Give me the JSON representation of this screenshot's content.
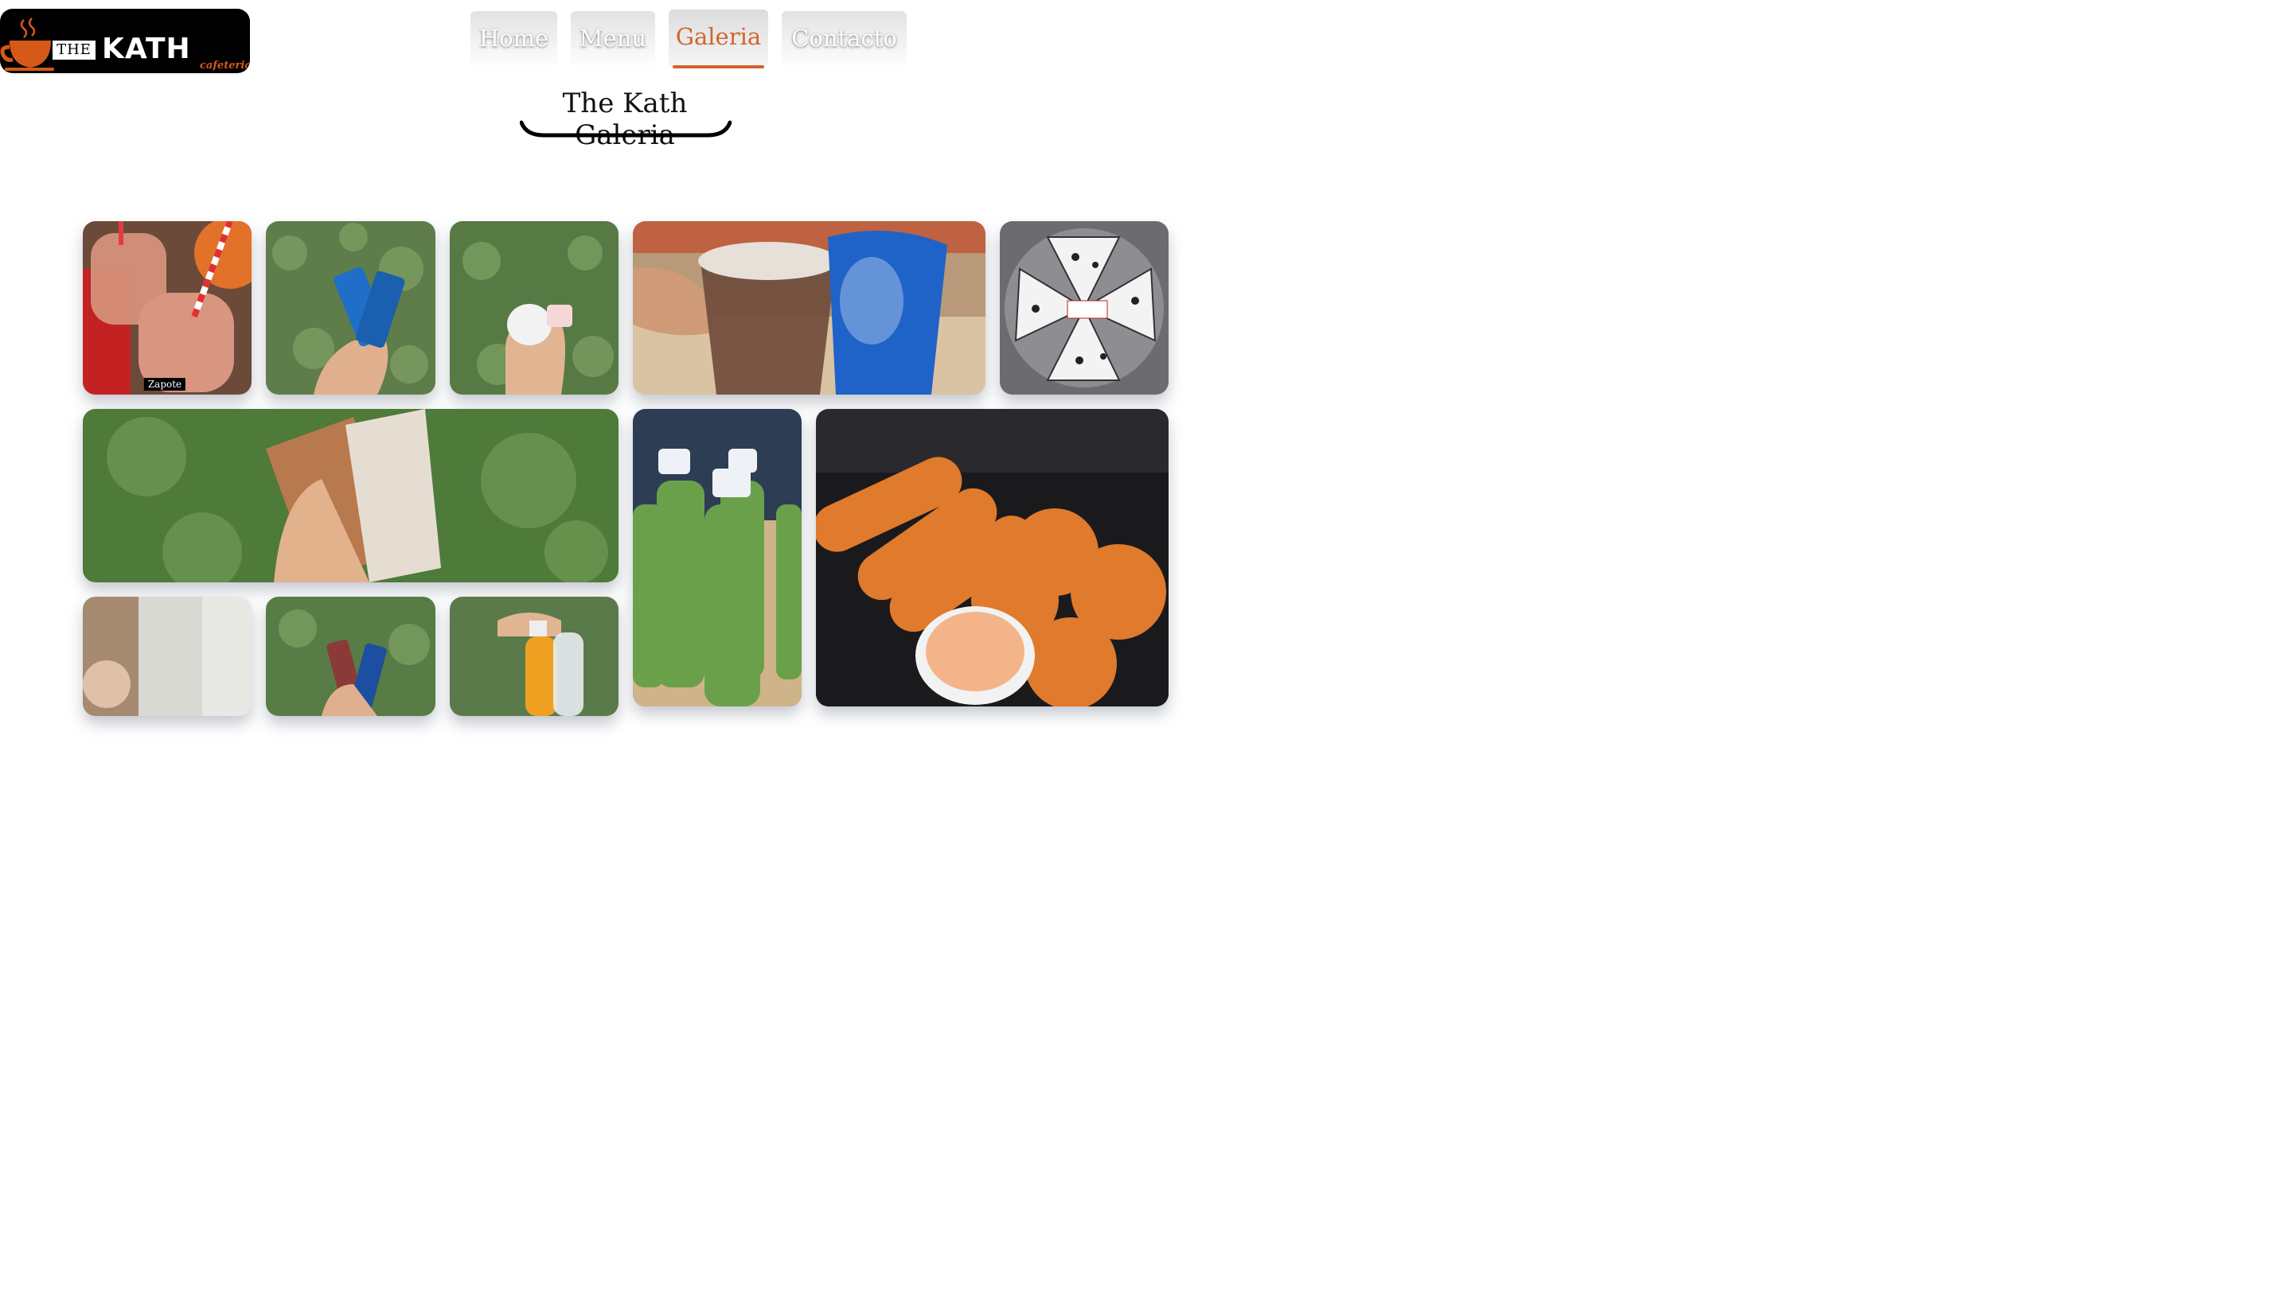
{
  "logo": {
    "the": "THE",
    "name": "KATH",
    "tagline": "cafeteria"
  },
  "nav": {
    "items": [
      {
        "label": "Home",
        "active": false
      },
      {
        "label": "Menu",
        "active": false
      },
      {
        "label": "Galeria",
        "active": true
      },
      {
        "label": "Contacto",
        "active": false
      }
    ]
  },
  "page": {
    "title": "The Kath Galeria"
  },
  "gallery": {
    "items": [
      {
        "caption": "Zapote"
      }
    ]
  },
  "colors": {
    "accent": "#d1652f",
    "logo_bg": "#000000"
  }
}
